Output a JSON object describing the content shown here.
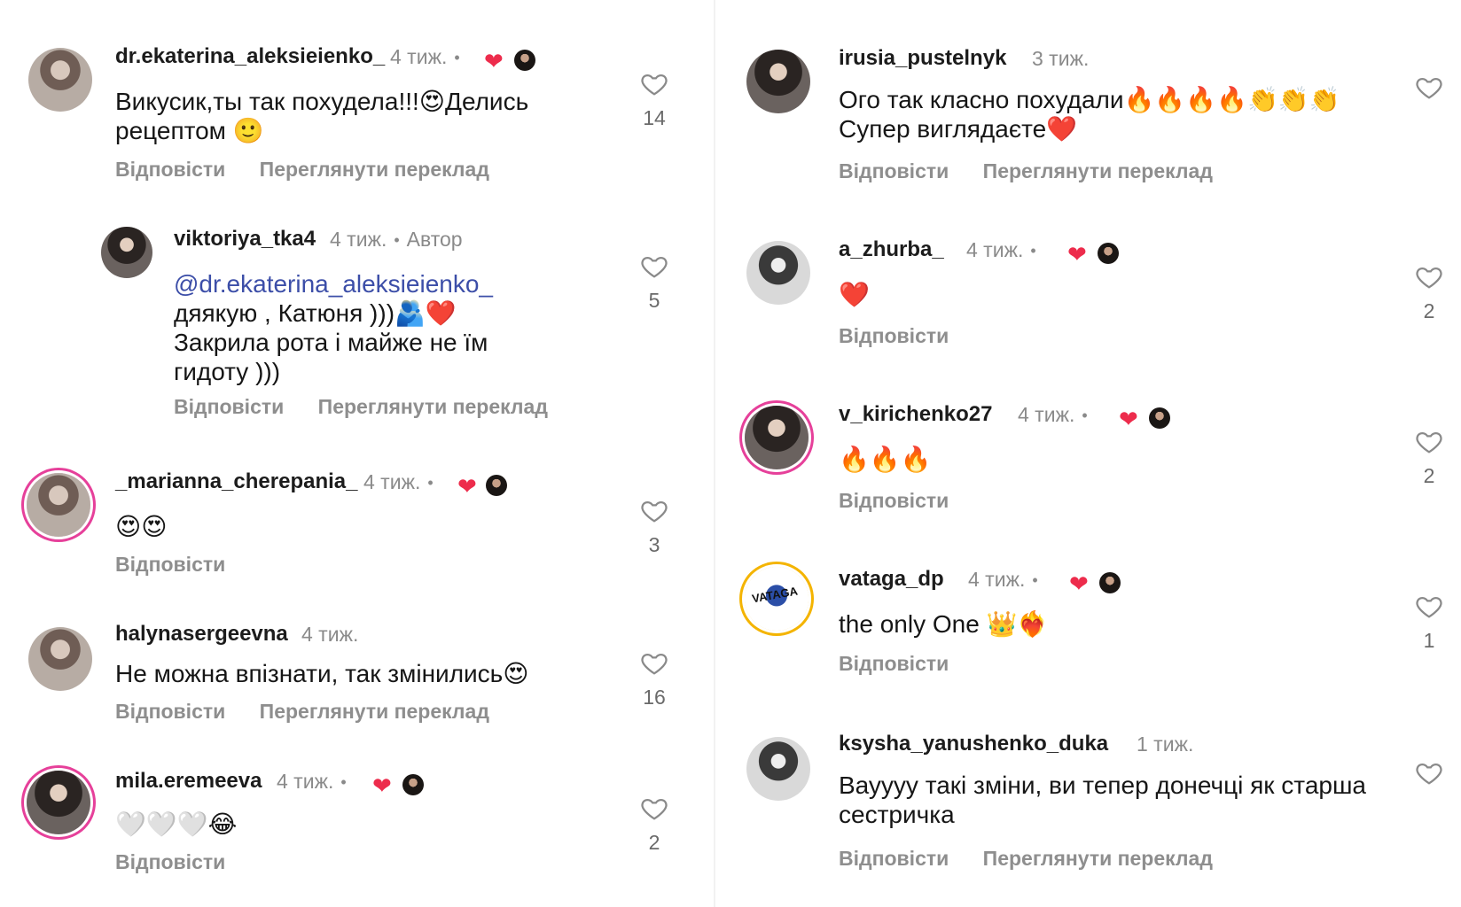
{
  "comments_left": [
    {
      "username": "dr.ekaterina_aleksieienko_",
      "time": "4 тиж.",
      "text": "Викусик,ты так похудела!!!😍Делись рецептом 🙂",
      "reply": "Відповісти",
      "translate": "Переглянути переклад",
      "likes": "14"
    },
    {
      "username": "viktoriya_tka4",
      "time": "4 тиж.",
      "author": "Автор",
      "mention": "@dr.ekaterina_aleksieienko_",
      "text": "дяякую , Катюня )))🫂❤️ Закрила рота і майже не їм гидоту )))",
      "reply": "Відповісти",
      "translate": "Переглянути переклад",
      "likes": "5"
    },
    {
      "username": "_marianna_cherepania_",
      "time": "4 тиж.",
      "text": "😍😍",
      "reply": "Відповісти",
      "likes": "3"
    },
    {
      "username": "halynasergeevna",
      "time": "4 тиж.",
      "text": "Не можна впізнати, так змінились😍",
      "reply": "Відповісти",
      "translate": "Переглянути переклад",
      "likes": "16"
    },
    {
      "username": "mila.eremeeva",
      "time": "4 тиж.",
      "text": "🤍🤍🤍😂",
      "reply": "Відповісти",
      "likes": "2"
    }
  ],
  "comments_right": [
    {
      "username": "irusia_pustelnyk",
      "time": "3 тиж.",
      "text": "Ого так класно похудали🔥🔥🔥🔥👏👏👏Супер виглядаєте❤️",
      "reply": "Відповісти",
      "translate": "Переглянути переклад"
    },
    {
      "username": "a_zhurba_",
      "time": "4 тиж.",
      "text": "❤️",
      "reply": "Відповісти",
      "likes": "2"
    },
    {
      "username": "v_kirichenko27",
      "time": "4 тиж.",
      "text": "🔥🔥🔥",
      "reply": "Відповісти",
      "likes": "2"
    },
    {
      "username": "vataga_dp",
      "time": "4 тиж.",
      "text": "the only One 👑❤️‍🔥",
      "reply": "Відповісти",
      "likes": "1"
    },
    {
      "username": "ksysha_yanushenko_duka",
      "time": "1 тиж.",
      "text": "Вауууу такі зміни, ви тепер донечці як старша сестричка",
      "reply": "Відповісти",
      "translate": "Переглянути переклад"
    }
  ],
  "icons": {
    "like": "heart-outline-icon",
    "creator_liked": "red-heart-icon"
  },
  "colors": {
    "mention": "#3c4ea8",
    "heart": "#ed2c4c",
    "muted": "#8e8e8e"
  }
}
